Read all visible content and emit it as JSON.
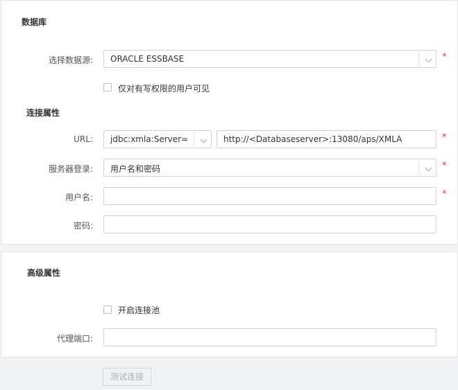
{
  "database": {
    "title": "数据库",
    "datasource_label": "选择数据源:",
    "datasource_value": "ORACLE ESSBASE",
    "write_only_checkbox": "仅对有写权限的用户可见"
  },
  "connection": {
    "title": "连接属性",
    "url_label": "URL:",
    "url_prefix": "jdbc:xmla:Server=",
    "url_value": "http://<Databaseserver>:13080/aps/XMLA",
    "login_label": "服务器登录:",
    "login_value": "用户名和密码",
    "username_label": "用户名:",
    "username_value": "",
    "password_label": "密码:",
    "password_value": ""
  },
  "advanced": {
    "title": "高级属性",
    "pool_checkbox": "开启连接池",
    "proxy_port_label": "代理端口:",
    "proxy_port_value": ""
  },
  "required_mark": "*",
  "actions": {
    "test_label": "测试连接"
  }
}
